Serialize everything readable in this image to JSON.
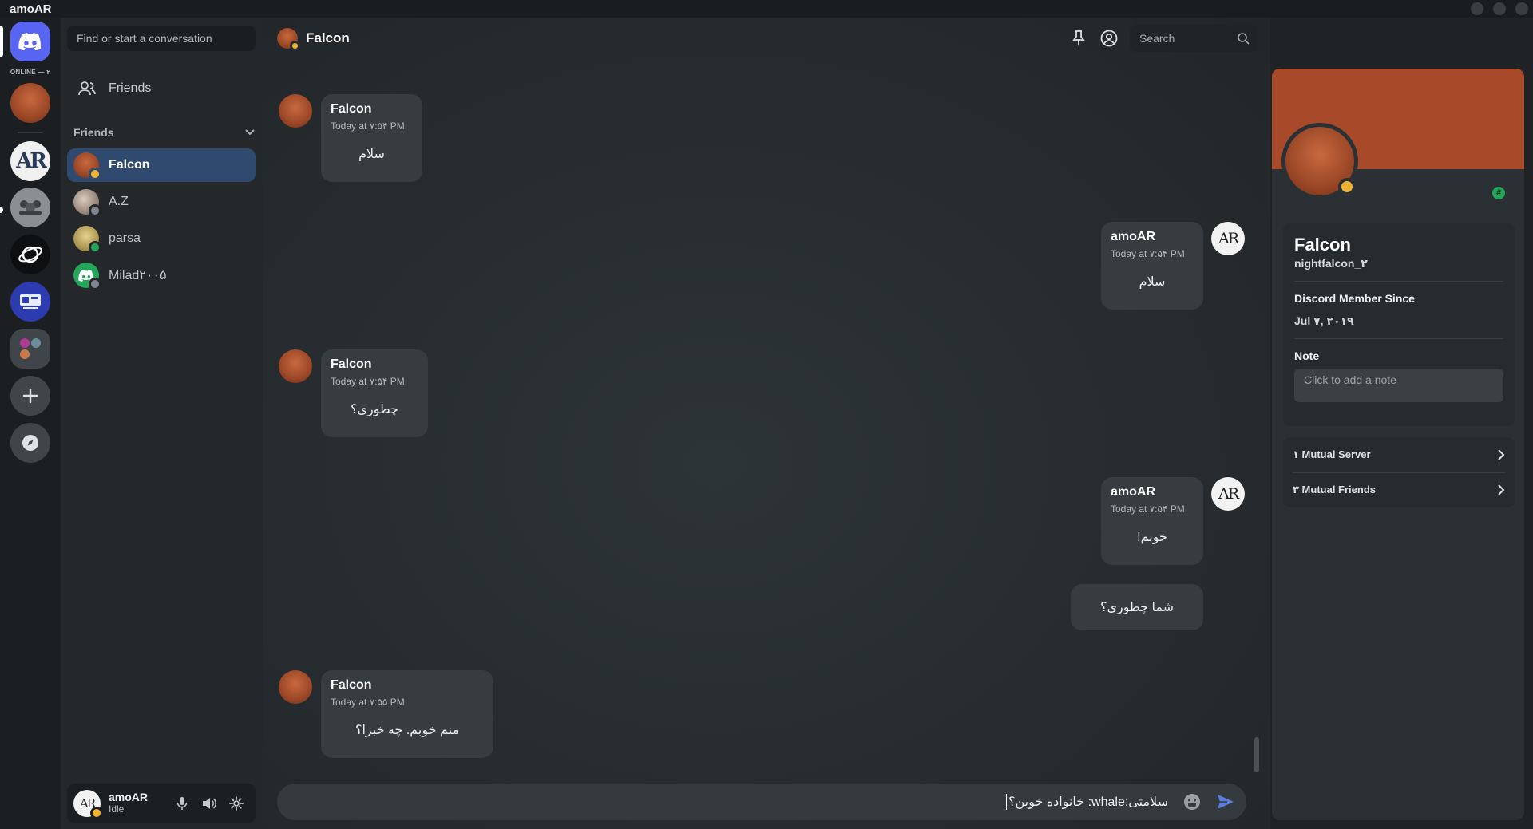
{
  "app": {
    "title": "amoAR"
  },
  "rail": {
    "online_label": "ONLINE — ۲",
    "items": [
      "discord-home",
      "falcon-dm",
      "ar-server",
      "group-server",
      "planet-server",
      "crossout-server",
      "folder-server",
      "add-server",
      "discover"
    ]
  },
  "dm": {
    "search_placeholder": "Find or start a conversation",
    "friends_nav": "Friends",
    "friends_header": "Friends",
    "friends": [
      {
        "name": "Falcon",
        "status": "idle",
        "active": true
      },
      {
        "name": "A.Z",
        "status": "offline",
        "active": false
      },
      {
        "name": "parsa",
        "status": "online",
        "active": false
      },
      {
        "name": "Milad۲۰۰۵",
        "status": "offline",
        "active": false
      }
    ]
  },
  "user_bar": {
    "name": "amoAR",
    "status": "Idle"
  },
  "chat": {
    "title": "Falcon",
    "search_placeholder": "Search",
    "messages": [
      {
        "author": "Falcon",
        "time": "Today at ۷:۵۴ PM",
        "text": "سلام"
      },
      {
        "author": "amoAR",
        "time": "Today at ۷:۵۴ PM",
        "text": "سلام"
      },
      {
        "author": "Falcon",
        "time": "Today at ۷:۵۴ PM",
        "text": "چطوری؟"
      },
      {
        "author": "amoAR",
        "time": "Today at ۷:۵۴ PM",
        "text": "خوبم!"
      },
      {
        "author": "amoAR",
        "time": "",
        "text": "شما چطوری؟"
      },
      {
        "author": "Falcon",
        "time": "Today at ۷:۵۵ PM",
        "text": "منم خوبم. چه خبرا؟"
      }
    ],
    "composer_value": "سلامتی:whale: خانواده خوبن؟"
  },
  "profile": {
    "display_name": "Falcon",
    "username": "nightfalcon_۲",
    "member_since_label": "Discord Member Since",
    "member_since": "Jul ۷, ۲۰۱۹",
    "note_label": "Note",
    "note_placeholder": "Click to add a note",
    "badge": "#",
    "mutual_server": "۱ Mutual Server",
    "mutual_friends": "۳ Mutual Friends"
  },
  "colors": {
    "accent": "#5865f2",
    "active_dm": "#2f4a6e",
    "online": "#23a55a",
    "idle": "#f0b232",
    "banner": "#a84a2a"
  }
}
